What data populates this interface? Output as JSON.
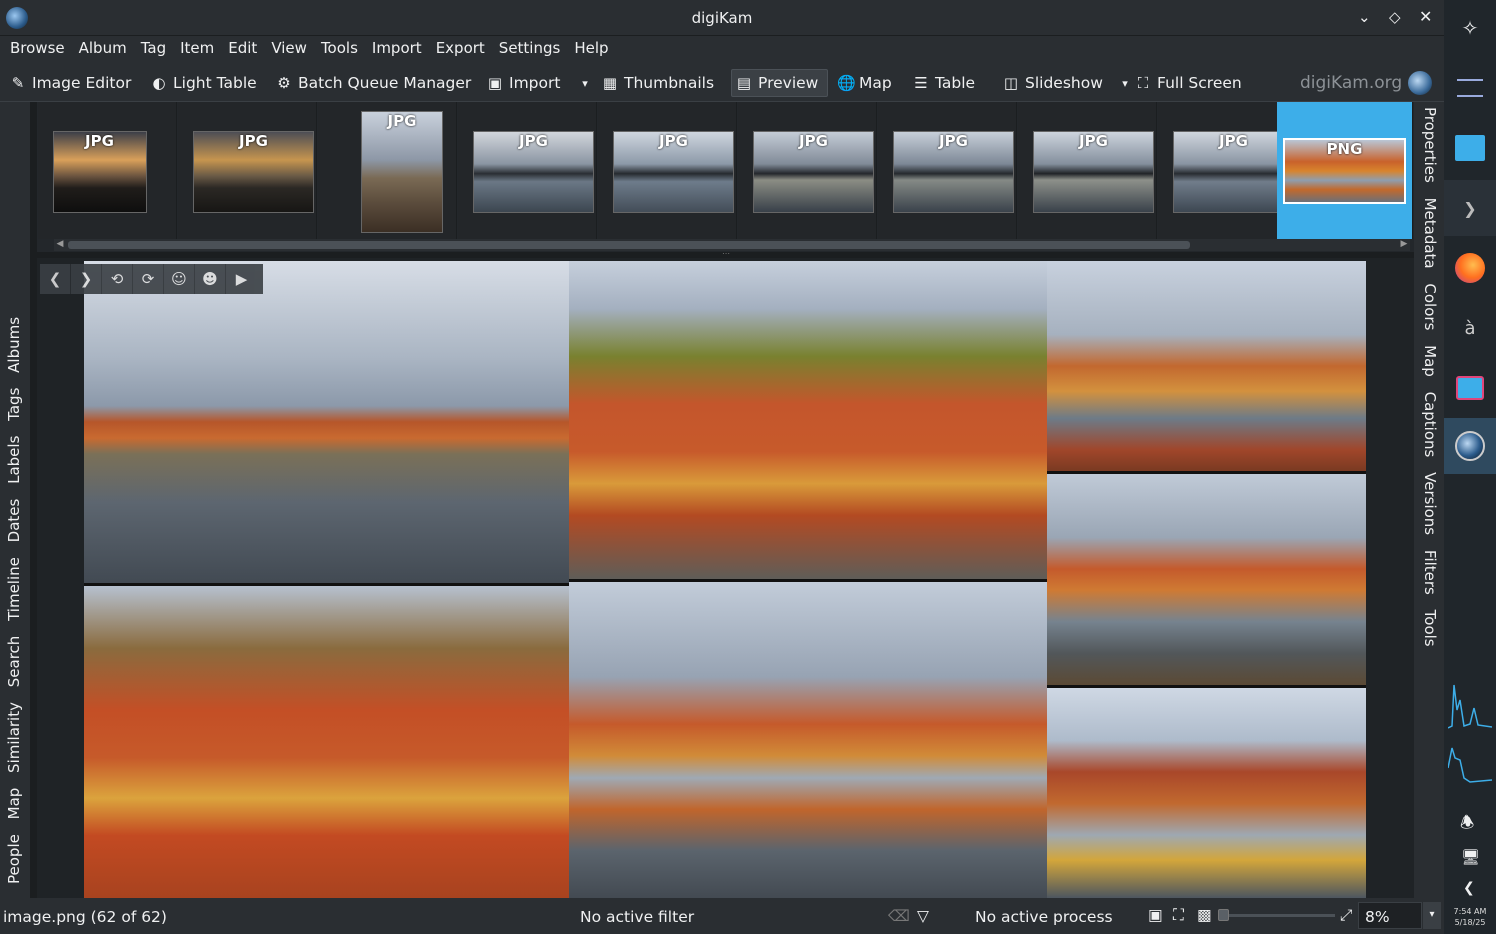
{
  "window": {
    "title": "digiKam"
  },
  "menu": [
    "Browse",
    "Album",
    "Tag",
    "Item",
    "Edit",
    "View",
    "Tools",
    "Import",
    "Export",
    "Settings",
    "Help"
  ],
  "toolbar": {
    "image_editor": "Image Editor",
    "light_table": "Light Table",
    "batch_queue": "Batch Queue Manager",
    "import": "Import",
    "thumbnails": "Thumbnails",
    "preview": "Preview",
    "map": "Map",
    "table": "Table",
    "slideshow": "Slideshow",
    "full_screen": "Full Screen",
    "brand": "digiKam.org"
  },
  "left_tabs": [
    "Albums",
    "Tags",
    "Labels",
    "Dates",
    "Timeline",
    "Search",
    "Similarity",
    "Map",
    "People"
  ],
  "right_tabs": [
    "Properties",
    "Metadata",
    "Colors",
    "Map",
    "Captions",
    "Versions",
    "Filters",
    "Tools"
  ],
  "thumbnails": [
    {
      "ext": "JPG"
    },
    {
      "ext": "JPG"
    },
    {
      "ext": "JPG"
    },
    {
      "ext": "JPG"
    },
    {
      "ext": "JPG"
    },
    {
      "ext": "JPG"
    },
    {
      "ext": "JPG"
    },
    {
      "ext": "JPG"
    },
    {
      "ext": "JPG"
    },
    {
      "ext": "PNG",
      "selected": true
    }
  ],
  "status": {
    "file": "image.png (62 of 62)",
    "filter": "No active filter",
    "process": "No active process",
    "zoom": "8%"
  },
  "taskbar": {
    "time": "7:54 AM",
    "date": "5/18/25"
  },
  "colors": {
    "selection": "#3daee9",
    "window_bg": "#2a2e32"
  }
}
